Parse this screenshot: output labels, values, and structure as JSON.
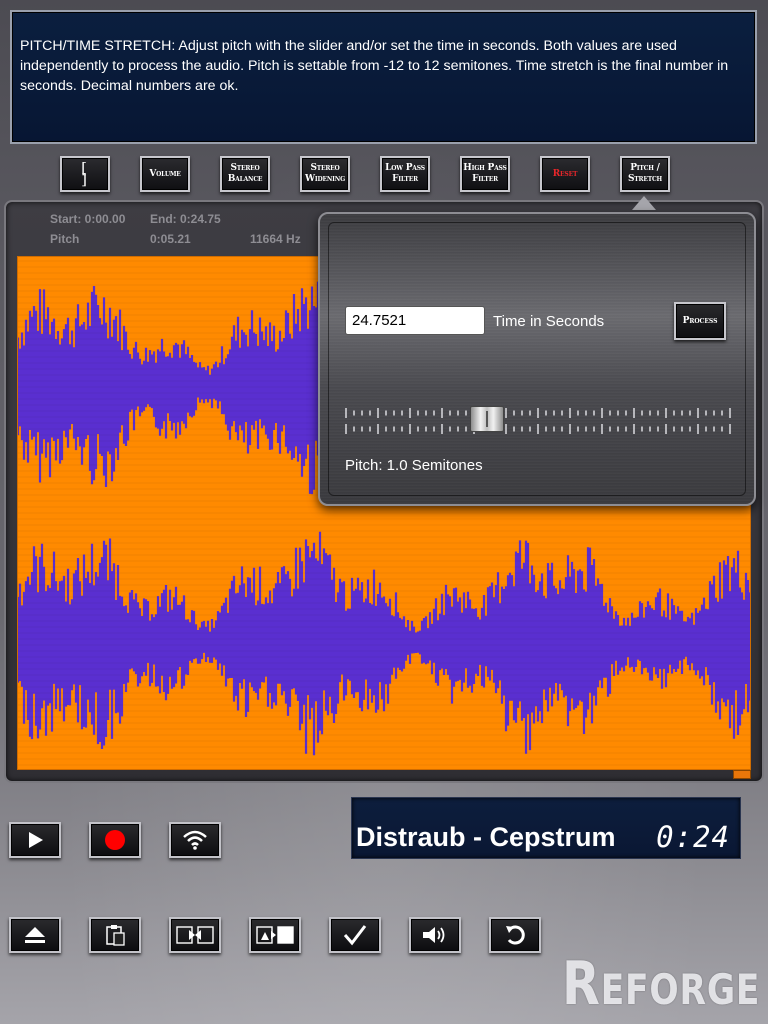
{
  "help": {
    "text": "PITCH/TIME STRETCH: Adjust pitch with the slider and/or set the time in seconds. Both values are used independently to process the audio. Pitch is settable from -12 to 12 semitones. Time stretch is the final number in seconds. Decimal numbers are ok."
  },
  "toolbar": {
    "buttons": [
      {
        "label": "[ ]",
        "icon": "bracket-icon"
      },
      {
        "label": "Volume"
      },
      {
        "label": "Stereo Balance"
      },
      {
        "label": "Stereo Widening"
      },
      {
        "label": "Low Pass Filter"
      },
      {
        "label": "High Pass Filter"
      },
      {
        "label": "Reset",
        "color": "#e8262a"
      },
      {
        "label": "Pitch / Stretch"
      }
    ]
  },
  "waveform": {
    "start": "Start: 0:00.00",
    "end": "End: 0:24.75",
    "pitch_label": "Pitch",
    "position": "0:05.21",
    "frequency": "11664 Hz",
    "background_color": "#ff8a00",
    "wave_color": "#5a2fd0"
  },
  "pitch_popup": {
    "time_value": "24.7521",
    "time_label": "Time in Seconds",
    "process_label": "Process",
    "pitch_text": "Pitch: 1.0 Semitones",
    "pitch_min": -12,
    "pitch_max": 12,
    "pitch_value": 1.0
  },
  "transport": {
    "play_icon": "play-icon",
    "record_icon": "record-icon",
    "wifi_icon": "wifi-icon",
    "record_color": "#ff0000"
  },
  "now_playing": {
    "track": "Distraub - Cepstrum",
    "time": "0:24"
  },
  "bottom_toolbar": {
    "icons": [
      "eject-icon",
      "clipboard-icon",
      "swap-left-icon",
      "swap-right-icon",
      "check-icon",
      "speaker-wave-icon",
      "undo-icon"
    ]
  },
  "logo": {
    "text": "Reforge"
  }
}
